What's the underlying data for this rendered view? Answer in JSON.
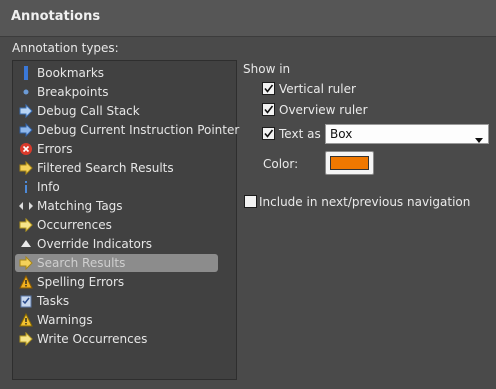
{
  "panel": {
    "title": "Annotations"
  },
  "annotation_types": {
    "label": "Annotation types:",
    "selected_index": 10,
    "items": [
      {
        "label": "Bookmarks",
        "icon": "bookmark-icon"
      },
      {
        "label": "Breakpoints",
        "icon": "breakpoint-icon"
      },
      {
        "label": "Debug Call Stack",
        "icon": "debug-call-stack-icon"
      },
      {
        "label": "Debug Current Instruction Pointer",
        "icon": "instruction-pointer-icon"
      },
      {
        "label": "Errors",
        "icon": "error-icon"
      },
      {
        "label": "Filtered Search Results",
        "icon": "filtered-search-icon"
      },
      {
        "label": "Info",
        "icon": "info-icon"
      },
      {
        "label": "Matching Tags",
        "icon": "matching-tags-icon"
      },
      {
        "label": "Occurrences",
        "icon": "occurrences-icon"
      },
      {
        "label": "Override Indicators",
        "icon": "override-indicator-icon"
      },
      {
        "label": "Search Results",
        "icon": "search-results-icon"
      },
      {
        "label": "Spelling Errors",
        "icon": "spelling-error-icon"
      },
      {
        "label": "Tasks",
        "icon": "tasks-icon"
      },
      {
        "label": "Warnings",
        "icon": "warning-icon"
      },
      {
        "label": "Write Occurrences",
        "icon": "write-occurrences-icon"
      }
    ]
  },
  "show_in": {
    "label": "Show in",
    "vertical_ruler": {
      "label": "Vertical ruler",
      "checked": true
    },
    "overview_ruler": {
      "label": "Overview ruler",
      "checked": true
    },
    "text_as": {
      "label": "Text as",
      "checked": true,
      "value": "Box"
    },
    "color_label": "Color:",
    "color": "#f07800"
  },
  "include_navigation": {
    "label": "Include in next/previous navigation",
    "checked": false
  }
}
